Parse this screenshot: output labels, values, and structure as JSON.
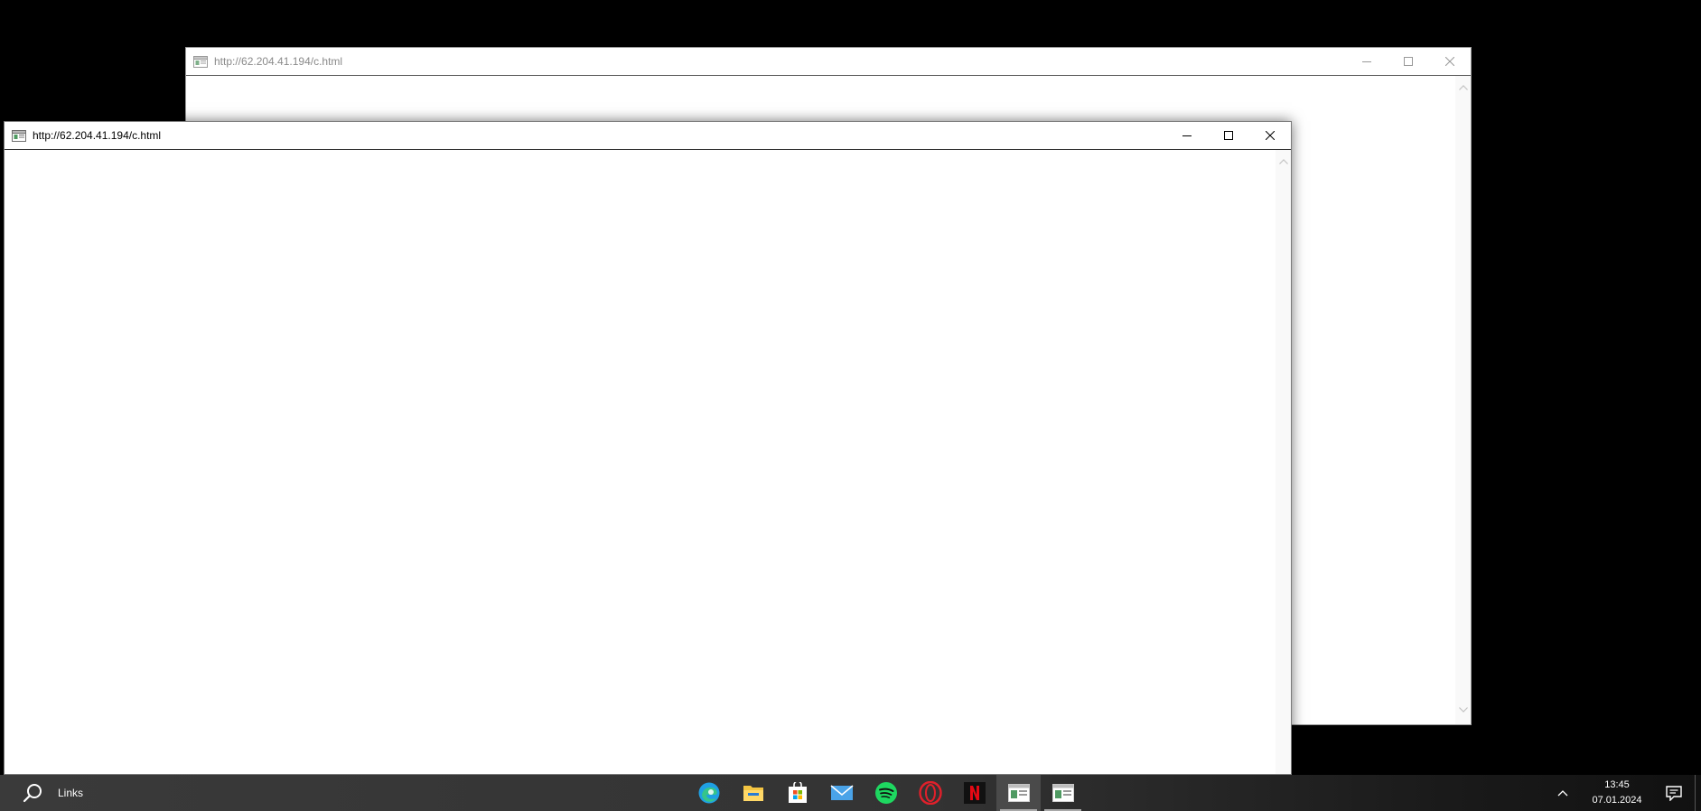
{
  "desktop": {
    "background": "#000000"
  },
  "windows": {
    "back": {
      "title": "http://62.204.41.194/c.html",
      "icon": "app-window-icon",
      "controls": [
        "minimize-icon",
        "maximize-icon",
        "close-icon"
      ],
      "state": "inactive"
    },
    "front": {
      "title": "http://62.204.41.194/c.html",
      "icon": "app-window-icon",
      "controls": [
        "minimize-icon",
        "maximize-icon",
        "close-icon"
      ],
      "state": "active"
    }
  },
  "taskbar": {
    "search_label": "Links",
    "pinned": [
      {
        "name": "edge-icon",
        "color": "#1fa0e3"
      },
      {
        "name": "file-explorer-icon",
        "color": "#f4c542"
      },
      {
        "name": "microsoft-store-icon",
        "color": "#ffffff"
      },
      {
        "name": "mail-icon",
        "color": "#4aa3e8"
      },
      {
        "name": "spotify-icon",
        "color": "#1ed760"
      },
      {
        "name": "opera-icon",
        "color": "#e0202b"
      },
      {
        "name": "netflix-icon",
        "color": "#e50914"
      },
      {
        "name": "app-window-icon",
        "running": true,
        "active": true
      },
      {
        "name": "app-window-icon",
        "running": true,
        "active": false
      }
    ],
    "clock": {
      "time": "13:45",
      "date": "07.01.2024"
    },
    "tray_icons": [
      "chevron-up-icon",
      "notification-icon"
    ]
  }
}
